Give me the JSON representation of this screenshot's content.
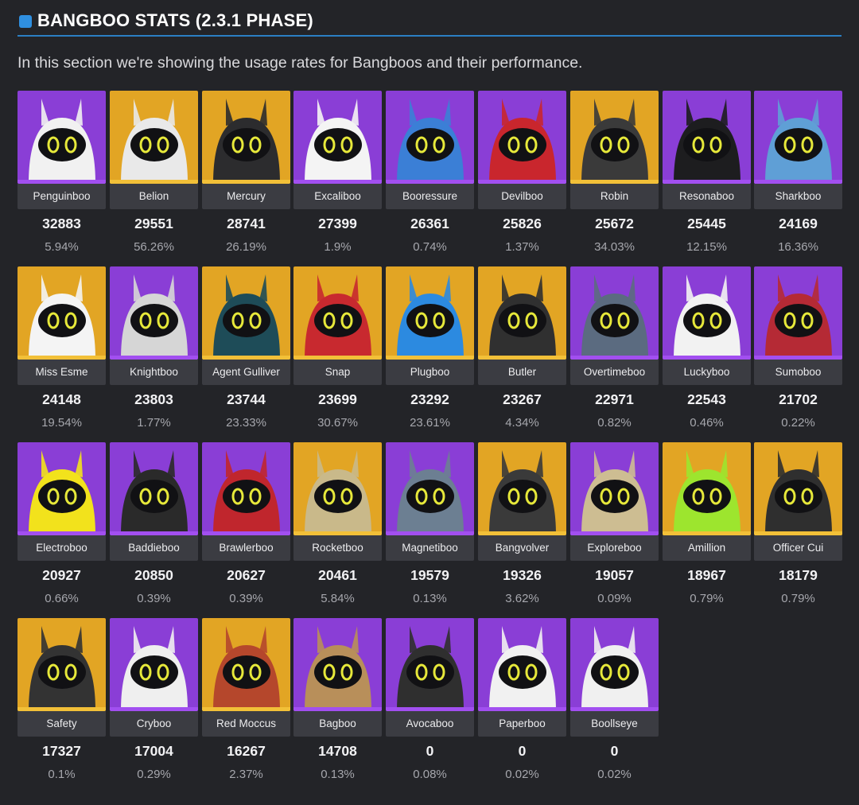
{
  "section": {
    "title": "BANGBOO STATS (2.3.1 PHASE)",
    "intro": "In this section we're showing the usage rates for Bangboos and their performance."
  },
  "colors": {
    "background": "#232428",
    "accent": "#2f8fe0",
    "rank_a_portrait": "#8a3ed6",
    "rank_s_portrait": "#e2a524",
    "rank_a_bar": "#a24ff0",
    "rank_s_bar": "#f2c038",
    "name_box": "#3b3c42"
  },
  "bangboos": [
    {
      "name": "Penguinboo",
      "count": "32883",
      "rate": "5.94%",
      "rank": "A",
      "icon": "penguin-bangboo-portrait-icon"
    },
    {
      "name": "Belion",
      "count": "29551",
      "rate": "56.26%",
      "rank": "S",
      "icon": "lion-bangboo-portrait-icon"
    },
    {
      "name": "Mercury",
      "count": "28741",
      "rate": "26.19%",
      "rank": "S",
      "icon": "helmet-bangboo-portrait-icon"
    },
    {
      "name": "Excaliboo",
      "count": "27399",
      "rate": "1.9%",
      "rank": "A",
      "icon": "crown-bangboo-portrait-icon"
    },
    {
      "name": "Booressure",
      "count": "26361",
      "rate": "0.74%",
      "rank": "A",
      "icon": "pressure-gauge-bangboo-portrait-icon"
    },
    {
      "name": "Devilboo",
      "count": "25826",
      "rate": "1.37%",
      "rank": "A",
      "icon": "devil-bangboo-portrait-icon"
    },
    {
      "name": "Robin",
      "count": "25672",
      "rate": "34.03%",
      "rank": "S",
      "icon": "bird-bangboo-portrait-icon"
    },
    {
      "name": "Resonaboo",
      "count": "25445",
      "rate": "12.15%",
      "rank": "A",
      "icon": "speaker-bangboo-portrait-icon"
    },
    {
      "name": "Sharkboo",
      "count": "24169",
      "rate": "16.36%",
      "rank": "A",
      "icon": "shark-bangboo-portrait-icon"
    },
    {
      "name": "Miss Esme",
      "count": "24148",
      "rate": "19.54%",
      "rank": "S",
      "icon": "bear-bangboo-portrait-icon"
    },
    {
      "name": "Knightboo",
      "count": "23803",
      "rate": "1.77%",
      "rank": "A",
      "icon": "knight-bangboo-portrait-icon"
    },
    {
      "name": "Agent Gulliver",
      "count": "23744",
      "rate": "23.33%",
      "rank": "S",
      "icon": "agent-bangboo-portrait-icon"
    },
    {
      "name": "Snap",
      "count": "23699",
      "rate": "30.67%",
      "rank": "S",
      "icon": "cap-bangboo-portrait-icon"
    },
    {
      "name": "Plugboo",
      "count": "23292",
      "rate": "23.61%",
      "rank": "S",
      "icon": "plug-bangboo-portrait-icon"
    },
    {
      "name": "Butler",
      "count": "23267",
      "rate": "4.34%",
      "rank": "S",
      "icon": "butler-bangboo-portrait-icon"
    },
    {
      "name": "Overtimeboo",
      "count": "22971",
      "rate": "0.82%",
      "rank": "A",
      "icon": "overtime-bangboo-portrait-icon"
    },
    {
      "name": "Luckyboo",
      "count": "22543",
      "rate": "0.46%",
      "rank": "A",
      "icon": "lucky-bangboo-portrait-icon"
    },
    {
      "name": "Sumoboo",
      "count": "21702",
      "rate": "0.22%",
      "rank": "A",
      "icon": "sumo-bangboo-portrait-icon"
    },
    {
      "name": "Electroboo",
      "count": "20927",
      "rate": "0.66%",
      "rank": "A",
      "icon": "electro-bangboo-portrait-icon"
    },
    {
      "name": "Baddieboo",
      "count": "20850",
      "rate": "0.39%",
      "rank": "A",
      "icon": "baddie-bangboo-portrait-icon"
    },
    {
      "name": "Brawlerboo",
      "count": "20627",
      "rate": "0.39%",
      "rank": "A",
      "icon": "brawler-bangboo-portrait-icon"
    },
    {
      "name": "Rocketboo",
      "count": "20461",
      "rate": "5.84%",
      "rank": "S",
      "icon": "goggles-bangboo-portrait-icon"
    },
    {
      "name": "Magnetiboo",
      "count": "19579",
      "rate": "0.13%",
      "rank": "A",
      "icon": "magnet-bangboo-portrait-icon"
    },
    {
      "name": "Bangvolver",
      "count": "19326",
      "rate": "3.62%",
      "rank": "S",
      "icon": "bangvolver-bangboo-portrait-icon"
    },
    {
      "name": "Exploreboo",
      "count": "19057",
      "rate": "0.09%",
      "rank": "A",
      "icon": "explorer-hat-bangboo-portrait-icon"
    },
    {
      "name": "Amillion",
      "count": "18967",
      "rate": "0.79%",
      "rank": "S",
      "icon": "amillion-bangboo-portrait-icon"
    },
    {
      "name": "Officer Cui",
      "count": "18179",
      "rate": "0.79%",
      "rank": "S",
      "icon": "officer-bangboo-portrait-icon"
    },
    {
      "name": "Safety",
      "count": "17327",
      "rate": "0.1%",
      "rank": "S",
      "icon": "hardhat-bangboo-portrait-icon"
    },
    {
      "name": "Cryboo",
      "count": "17004",
      "rate": "0.29%",
      "rank": "A",
      "icon": "glasses-bangboo-portrait-icon"
    },
    {
      "name": "Red Moccus",
      "count": "16267",
      "rate": "2.37%",
      "rank": "S",
      "icon": "boar-bangboo-portrait-icon"
    },
    {
      "name": "Bagboo",
      "count": "14708",
      "rate": "0.13%",
      "rank": "A",
      "icon": "paper-bag-bangboo-portrait-icon"
    },
    {
      "name": "Avocaboo",
      "count": "0",
      "rate": "0.08%",
      "rank": "A",
      "icon": "avocado-bangboo-portrait-icon"
    },
    {
      "name": "Paperboo",
      "count": "0",
      "rate": "0.02%",
      "rank": "A",
      "icon": "paper-bangboo-portrait-icon"
    },
    {
      "name": "Boollseye",
      "count": "0",
      "rate": "0.02%",
      "rank": "A",
      "icon": "bullseye-bangboo-portrait-icon"
    }
  ]
}
